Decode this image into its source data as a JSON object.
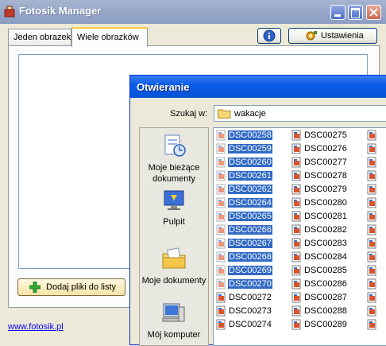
{
  "window": {
    "title": "Fotosik Manager"
  },
  "tabs": [
    {
      "label": "Jeden obrazek"
    },
    {
      "label": "Wiele obrazków"
    }
  ],
  "toolbar": {
    "settings_label": "Ustawienia"
  },
  "add_files_label": "Dodaj pliki do listy",
  "footer_link": "www.fotosik.pl",
  "dialog": {
    "title": "Otwieranie",
    "look_in_label": "Szukaj w:",
    "look_in_value": "wakacje",
    "places": [
      {
        "label": "Moje bieżące dokumenty",
        "icon": "recent-documents-icon"
      },
      {
        "label": "Pulpit",
        "icon": "desktop-icon"
      },
      {
        "label": "Moje dokumenty",
        "icon": "my-documents-icon"
      },
      {
        "label": "Mój komputer",
        "icon": "my-computer-icon"
      }
    ],
    "files_col1": [
      {
        "name": "DSC00258",
        "selected": true
      },
      {
        "name": "DSC00259",
        "selected": true
      },
      {
        "name": "DSC00260",
        "selected": true
      },
      {
        "name": "DSC00261",
        "selected": true
      },
      {
        "name": "DSC00262",
        "selected": true
      },
      {
        "name": "DSC00264",
        "selected": true
      },
      {
        "name": "DSC00265",
        "selected": true
      },
      {
        "name": "DSC00266",
        "selected": true
      },
      {
        "name": "DSC00267",
        "selected": true
      },
      {
        "name": "DSC00268",
        "selected": true
      },
      {
        "name": "DSC00269",
        "selected": true
      },
      {
        "name": "DSC00270",
        "selected": true
      },
      {
        "name": "DSC00272",
        "selected": false
      },
      {
        "name": "DSC00273",
        "selected": false
      },
      {
        "name": "DSC00274",
        "selected": false
      }
    ],
    "files_col2": [
      {
        "name": "DSC00275"
      },
      {
        "name": "DSC00276"
      },
      {
        "name": "DSC00277"
      },
      {
        "name": "DSC00278"
      },
      {
        "name": "DSC00279"
      },
      {
        "name": "DSC00280"
      },
      {
        "name": "DSC00281"
      },
      {
        "name": "DSC00282"
      },
      {
        "name": "DSC00283"
      },
      {
        "name": "DSC00284"
      },
      {
        "name": "DSC00285"
      },
      {
        "name": "DSC00286"
      },
      {
        "name": "DSC00287"
      },
      {
        "name": "DSC00288"
      },
      {
        "name": "DSC00289"
      }
    ],
    "selection_color": "#316AC5"
  }
}
